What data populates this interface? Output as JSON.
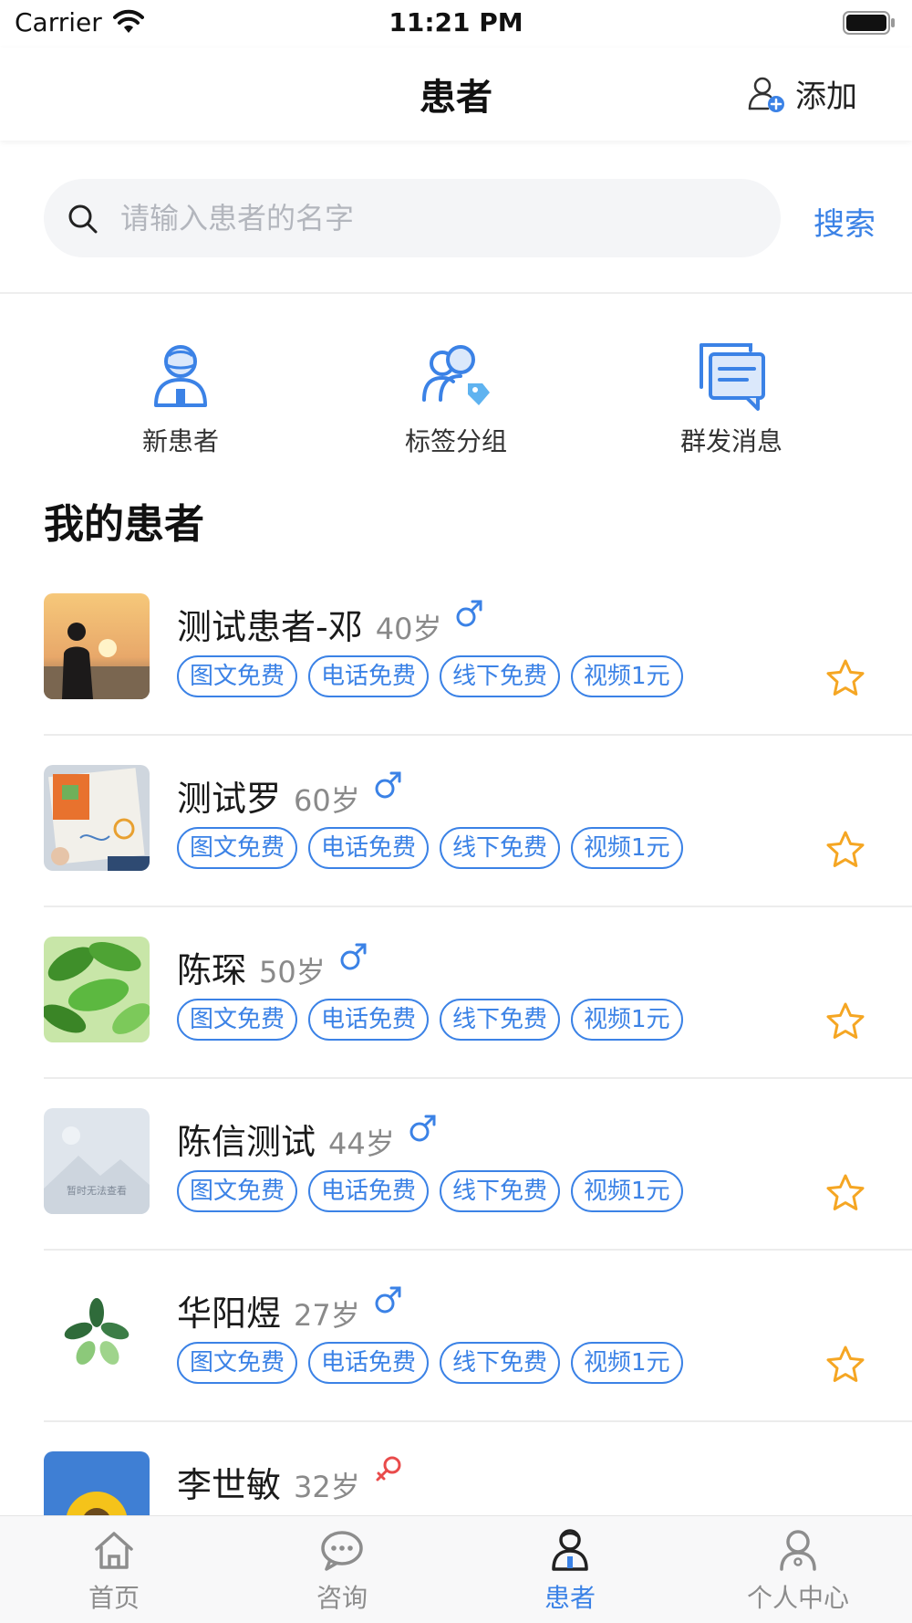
{
  "status_bar": {
    "carrier": "Carrier",
    "time": "11:21 PM"
  },
  "nav": {
    "title": "患者",
    "add_label": "添加"
  },
  "search": {
    "placeholder": "请输入患者的名字",
    "button": "搜索"
  },
  "quick_actions": [
    {
      "label": "新患者",
      "icon": "new-patient-icon"
    },
    {
      "label": "标签分组",
      "icon": "tag-group-icon"
    },
    {
      "label": "群发消息",
      "icon": "broadcast-message-icon"
    }
  ],
  "section_title": "我的患者",
  "patients": [
    {
      "name": "测试患者-邓",
      "age": "40岁",
      "gender": "male",
      "avatar": "sunset-silhouette-photo",
      "tags": [
        "图文免费",
        "电话免费",
        "线下免费",
        "视频1元"
      ],
      "starred": false
    },
    {
      "name": "测试罗",
      "age": "60岁",
      "gender": "male",
      "avatar": "child-drawing-photo",
      "tags": [
        "图文免费",
        "电话免费",
        "线下免费",
        "视频1元"
      ],
      "starred": false
    },
    {
      "name": "陈琛",
      "age": "50岁",
      "gender": "male",
      "avatar": "green-leaves-photo",
      "tags": [
        "图文免费",
        "电话免费",
        "线下免费",
        "视频1元"
      ],
      "starred": false
    },
    {
      "name": "陈信测试",
      "age": "44岁",
      "gender": "male",
      "avatar": "image-unavailable-placeholder",
      "avatar_caption": "暂时无法查看",
      "tags": [
        "图文免费",
        "电话免费",
        "线下免费",
        "视频1元"
      ],
      "starred": false
    },
    {
      "name": "华阳煜",
      "age": "27岁",
      "gender": "male",
      "avatar": "leaf-logo",
      "tags": [
        "图文免费",
        "电话免费",
        "线下免费",
        "视频1元"
      ],
      "starred": false
    },
    {
      "name": "李世敏",
      "age": "32岁",
      "gender": "female",
      "avatar": "sunflower-photo",
      "tags": [],
      "starred": false
    }
  ],
  "tab_bar": [
    {
      "label": "首页",
      "icon": "home-icon",
      "active": false
    },
    {
      "label": "咨询",
      "icon": "chat-icon",
      "active": false
    },
    {
      "label": "患者",
      "icon": "patient-icon",
      "active": true
    },
    {
      "label": "个人中心",
      "icon": "profile-icon",
      "active": false
    }
  ],
  "colors": {
    "accent": "#3b82e6",
    "star": "#f5a623",
    "female": "#e94b4b",
    "text": "#1a1a1a",
    "muted": "#8a8a8a"
  }
}
